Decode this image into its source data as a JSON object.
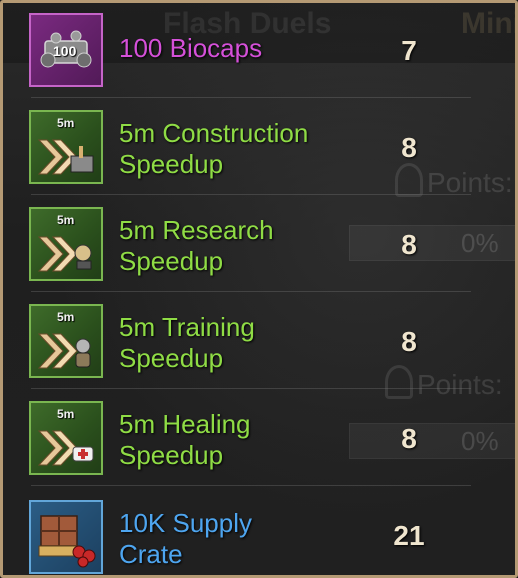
{
  "background": {
    "title": "Flash Duels",
    "mini": "Mini",
    "points_label": "Points:",
    "progress": "0%"
  },
  "rewards": [
    {
      "name": "100 Biocaps",
      "quantity": "7",
      "rarity_color": "#d550d9",
      "icon": "biocaps-icon",
      "icon_text": "100"
    },
    {
      "name_line1": "5m Construction",
      "name_line2": "Speedup",
      "quantity": "8",
      "rarity_color": "#8fdc45",
      "icon": "construction-speedup-icon",
      "icon_text": "5m"
    },
    {
      "name_line1": "5m Research",
      "name_line2": "Speedup",
      "quantity": "8",
      "rarity_color": "#8fdc45",
      "icon": "research-speedup-icon",
      "icon_text": "5m"
    },
    {
      "name_line1": "5m Training",
      "name_line2": "Speedup",
      "quantity": "8",
      "rarity_color": "#8fdc45",
      "icon": "training-speedup-icon",
      "icon_text": "5m"
    },
    {
      "name_line1": "5m Healing",
      "name_line2": "Speedup",
      "quantity": "8",
      "rarity_color": "#8fdc45",
      "icon": "healing-speedup-icon",
      "icon_text": "5m"
    },
    {
      "name_line1": "10K Supply",
      "name_line2": "Crate",
      "quantity": "21",
      "rarity_color": "#4ea5ef",
      "icon": "supply-crate-icon"
    }
  ]
}
